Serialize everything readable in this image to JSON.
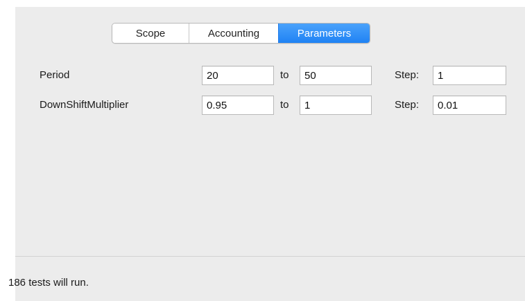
{
  "tabs": [
    {
      "label": "Scope",
      "selected": false
    },
    {
      "label": "Accounting",
      "selected": false
    },
    {
      "label": "Parameters",
      "selected": true
    }
  ],
  "parameters": [
    {
      "name": "Period",
      "from": "20",
      "to_label": "to",
      "to": "50",
      "step_label": "Step:",
      "step": "1"
    },
    {
      "name": "DownShiftMultiplier",
      "from": "0.95",
      "to_label": "to",
      "to": "1",
      "step_label": "Step:",
      "step": "0.01"
    }
  ],
  "status": {
    "text": "186 tests will run."
  },
  "colors": {
    "accent": "#2d8ff7",
    "panel_background": "#ececec"
  }
}
